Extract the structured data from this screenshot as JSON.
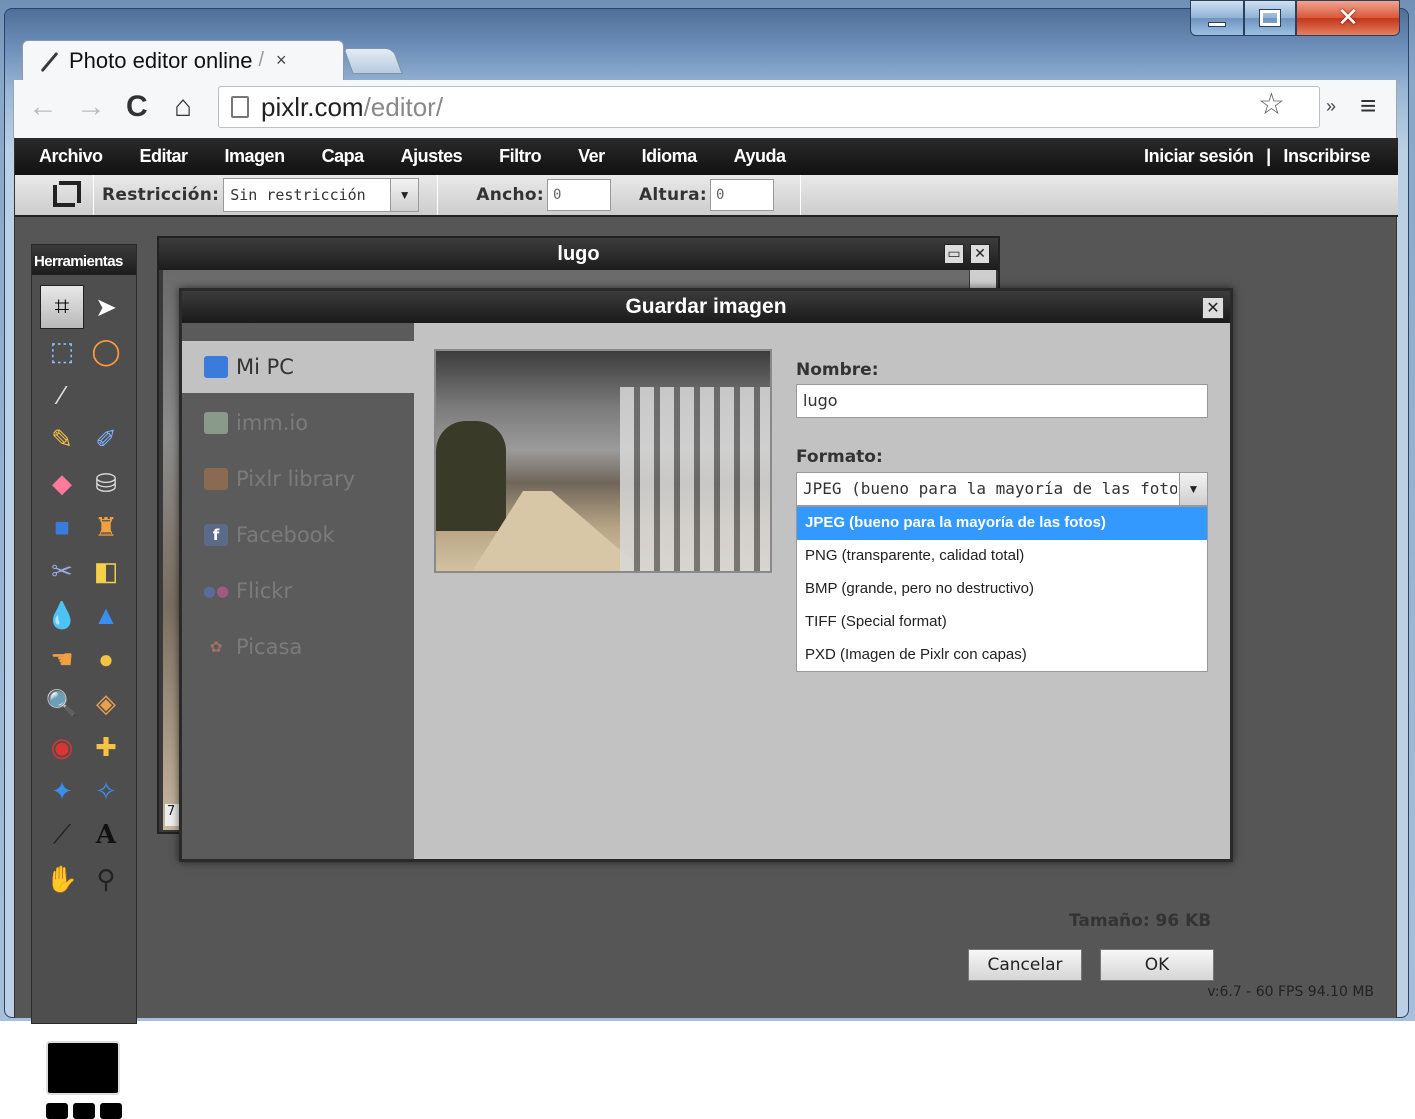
{
  "browser": {
    "tab_title": "Photo editor online",
    "tab_sep": "/",
    "tab_close": "×",
    "url_host": "pixlr.com",
    "url_path": "/editor/"
  },
  "app": {
    "menu": [
      "Archivo",
      "Editar",
      "Imagen",
      "Capa",
      "Ajustes",
      "Filtro",
      "Ver",
      "Idioma",
      "Ayuda"
    ],
    "login": "Iniciar sesión",
    "separator": "|",
    "register": "Inscribirse",
    "options": {
      "restriction_label": "Restricción:",
      "restriction_value": "Sin restricción",
      "width_label": "Ancho:",
      "width_value": "0",
      "height_label": "Altura:",
      "height_value": "0"
    },
    "tools_title": "Herramientas",
    "image_window": {
      "title": "lugo",
      "zoom_fragment": "7"
    },
    "version": "v:6.7 - 60 FPS 94.10 MB"
  },
  "dialog": {
    "title": "Guardar imagen",
    "close": "✕",
    "destinations": [
      "Mi PC",
      "imm.io",
      "Pixlr library",
      "Facebook",
      "Flickr",
      "Picasa"
    ],
    "name_label": "Nombre:",
    "name_value": "lugo",
    "format_label": "Formato:",
    "format_value": "JPEG (bueno para la mayoría de las fotos)",
    "format_options": [
      "JPEG (bueno para la mayoría de las fotos)",
      "PNG (transparente, calidad total)",
      "BMP (grande, pero no destructivo)",
      "TIFF (Special format)",
      "PXD (Imagen de Pixlr con capas)"
    ],
    "size": "Tamaño: 96 KB",
    "cancel": "Cancelar",
    "ok": "OK"
  },
  "colors": {
    "selection_blue": "#3399ff",
    "menubar": "#111111",
    "dialog_bg": "#c2c2c2"
  }
}
